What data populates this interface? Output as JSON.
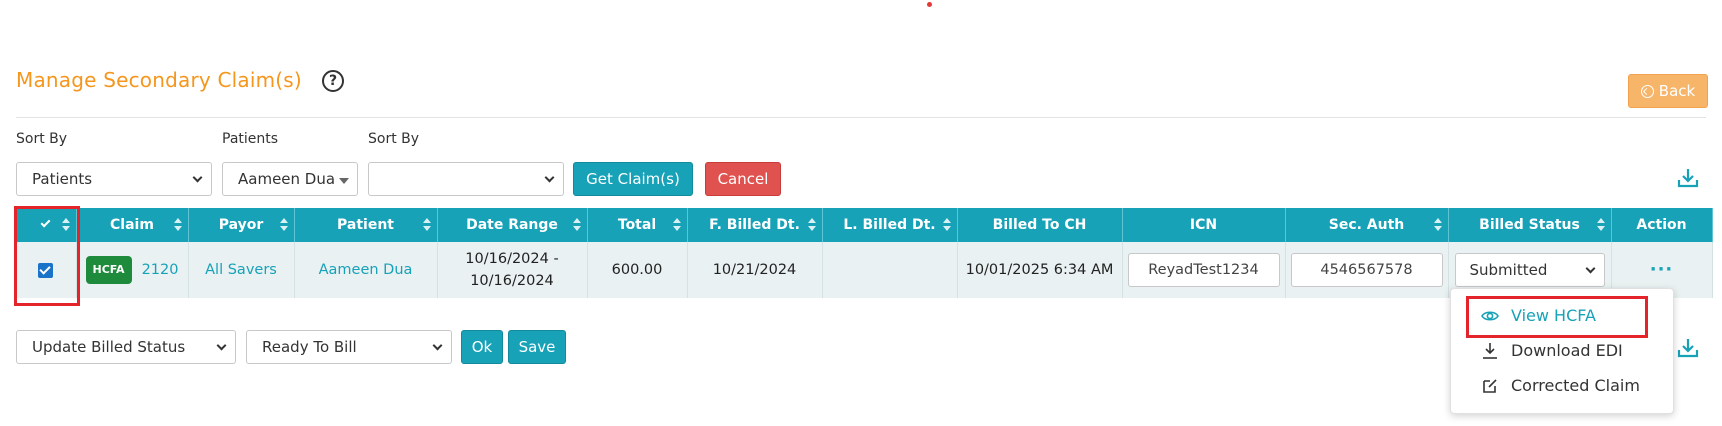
{
  "header": {
    "title": "Manage Secondary Claim(s)",
    "help_icon": "question-circle-icon",
    "back_label": "Back"
  },
  "filters": {
    "sort_by_label": "Sort By",
    "sort_by_value": "Patients",
    "patients_label": "Patients",
    "patients_value": "Aameen Dua",
    "sort_by2_label": "Sort By",
    "sort_by2_value": "",
    "get_claims_label": "Get Claim(s)",
    "cancel_label": "Cancel"
  },
  "table": {
    "columns": [
      "Claim",
      "Payor",
      "Patient",
      "Date Range",
      "Total",
      "F. Billed Dt.",
      "L. Billed Dt.",
      "Billed To CH",
      "ICN",
      "Sec. Auth",
      "Billed Status",
      "Action"
    ],
    "rows": [
      {
        "checked": true,
        "badge": "HCFA",
        "claim": "2120",
        "payor": "All Savers",
        "patient": "Aameen Dua",
        "date_range_from": "10/16/2024 -",
        "date_range_to": "10/16/2024",
        "total": "600.00",
        "f_billed_dt": "10/21/2024",
        "l_billed_dt": "",
        "billed_to_ch": "10/01/2025 6:34 AM",
        "icn": "ReyadTest1234",
        "sec_auth": "4546567578",
        "billed_status": "Submitted",
        "action": "···"
      }
    ]
  },
  "bottom": {
    "update_status_value": "Update Billed Status",
    "ready_value": "Ready To Bill",
    "ok_label": "Ok",
    "save_label": "Save"
  },
  "action_menu": {
    "items": [
      {
        "label": "View HCFA",
        "icon": "eye-icon"
      },
      {
        "label": "Download EDI",
        "icon": "download-icon"
      },
      {
        "label": "Corrected Claim",
        "icon": "edit-icon"
      }
    ]
  },
  "colors": {
    "accent": "#17a2b8",
    "title": "#f5961d",
    "cancel": "#e0524f",
    "back": "#f7b56a",
    "highlight": "#e3242b",
    "badge": "#1e8a3c"
  }
}
